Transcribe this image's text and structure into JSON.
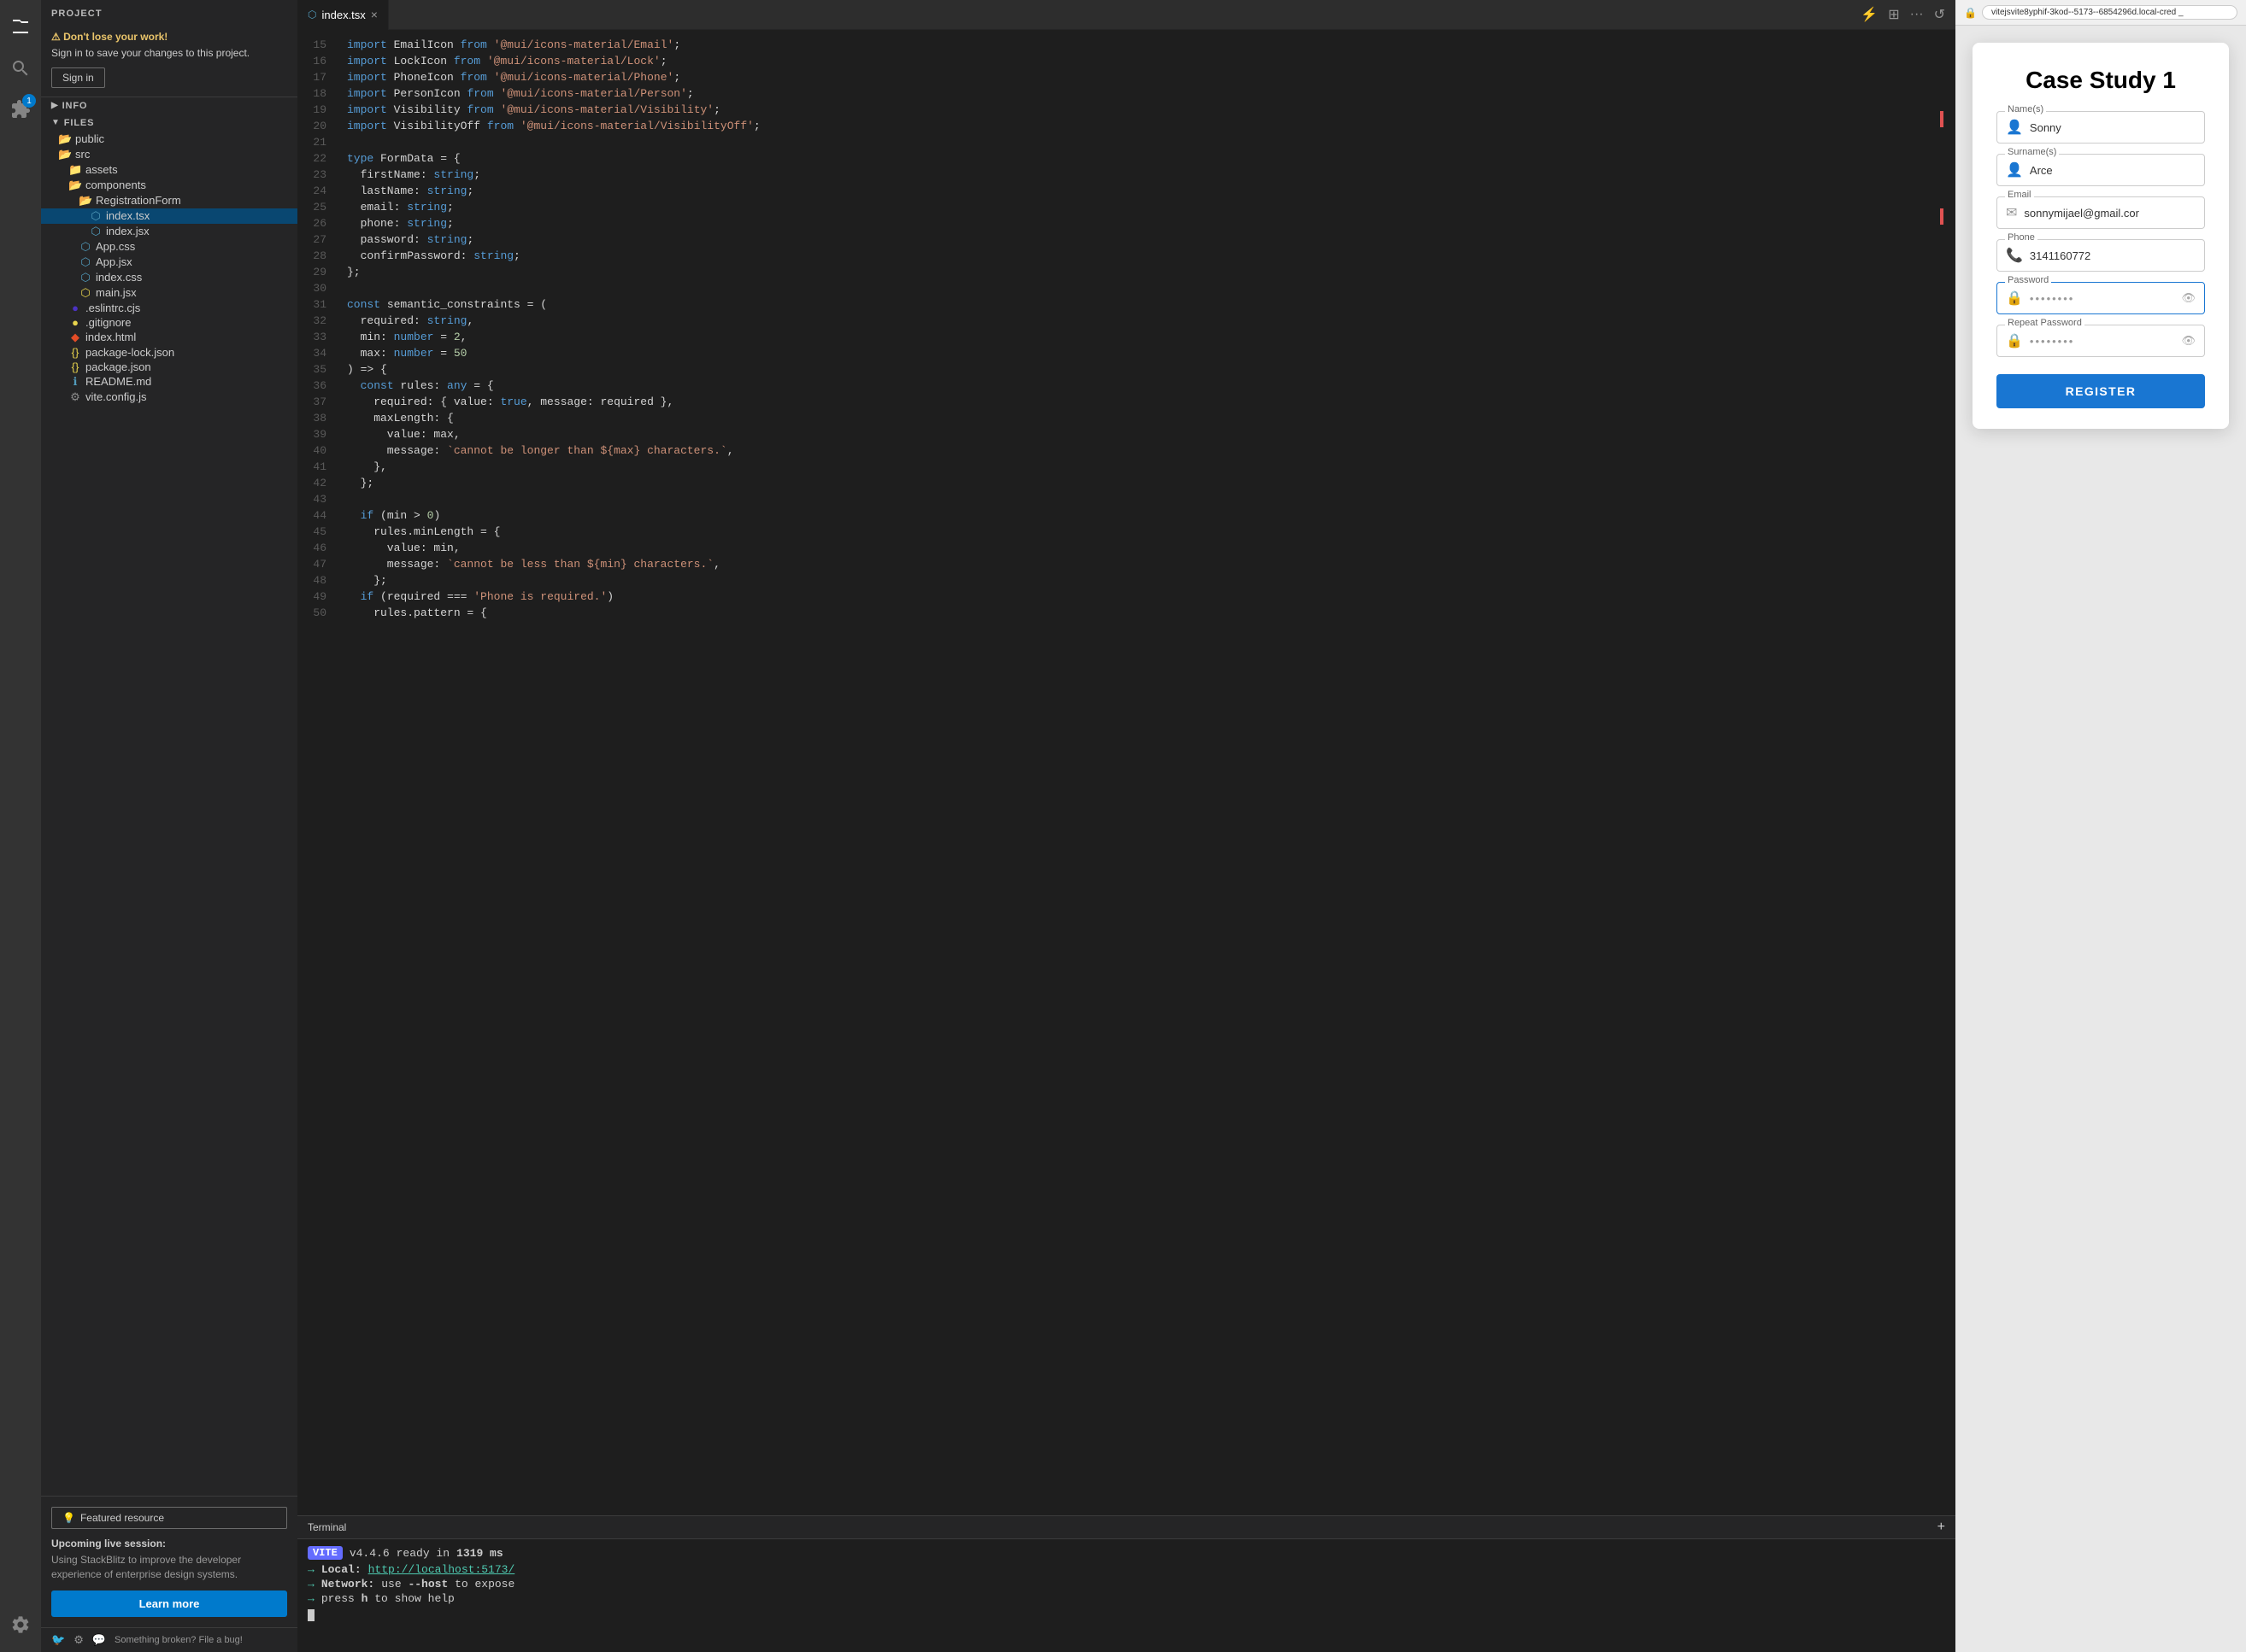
{
  "activityBar": {
    "icons": [
      "files",
      "search",
      "extensions",
      "settings"
    ]
  },
  "sidebar": {
    "projectLabel": "PROJECT",
    "warning": {
      "title": "⚠ Don't lose your work!",
      "text": "Sign in to save your changes to this project.",
      "signInLabel": "Sign in"
    },
    "infoSection": "INFO",
    "filesSection": "FILES",
    "fileTree": [
      {
        "name": "public",
        "type": "folder-open",
        "depth": 0
      },
      {
        "name": "src",
        "type": "folder-open",
        "depth": 0
      },
      {
        "name": "assets",
        "type": "folder",
        "depth": 1
      },
      {
        "name": "components",
        "type": "folder-open",
        "depth": 1
      },
      {
        "name": "RegistrationForm",
        "type": "folder-open",
        "depth": 2
      },
      {
        "name": "index.tsx",
        "type": "tsx",
        "depth": 3,
        "selected": true
      },
      {
        "name": "index.jsx",
        "type": "jsx",
        "depth": 3
      },
      {
        "name": "App.css",
        "type": "css",
        "depth": 2
      },
      {
        "name": "App.jsx",
        "type": "jsx",
        "depth": 2
      },
      {
        "name": "index.css",
        "type": "css",
        "depth": 2
      },
      {
        "name": "main.jsx",
        "type": "js",
        "depth": 2
      },
      {
        "name": ".eslintrc.cjs",
        "type": "eslint",
        "depth": 1
      },
      {
        "name": ".gitignore",
        "type": "git",
        "depth": 1
      },
      {
        "name": "index.html",
        "type": "html",
        "depth": 1
      },
      {
        "name": "package-lock.json",
        "type": "json",
        "depth": 1
      },
      {
        "name": "package.json",
        "type": "json",
        "depth": 1
      },
      {
        "name": "README.md",
        "type": "md",
        "depth": 1
      },
      {
        "name": "vite.config.js",
        "type": "config",
        "depth": 1
      }
    ],
    "featured": {
      "buttonLabel": "Featured resource",
      "upcomingTitle": "Upcoming live session:",
      "upcomingText": "Using StackBlitz to improve the developer experience of enterprise design systems.",
      "learnMoreLabel": "Learn more"
    },
    "footer": {
      "bugText": "Something broken? File a bug!"
    }
  },
  "editor": {
    "tab": {
      "filename": "index.tsx",
      "icon": "tsx"
    },
    "lines": [
      {
        "num": 15,
        "code": "import EmailIcon from '@mui/icons-material/Email';"
      },
      {
        "num": 16,
        "code": "import LockIcon from '@mui/icons-material/Lock';"
      },
      {
        "num": 17,
        "code": "import PhoneIcon from '@mui/icons-material/Phone';"
      },
      {
        "num": 18,
        "code": "import PersonIcon from '@mui/icons-material/Person';"
      },
      {
        "num": 19,
        "code": "import Visibility from '@mui/icons-material/Visibility';"
      },
      {
        "num": 20,
        "code": "import VisibilityOff from '@mui/icons-material/VisibilityOff';"
      },
      {
        "num": 21,
        "code": ""
      },
      {
        "num": 22,
        "code": "type FormData = {"
      },
      {
        "num": 23,
        "code": "  firstName: string;"
      },
      {
        "num": 24,
        "code": "  lastName: string;"
      },
      {
        "num": 25,
        "code": "  email: string;"
      },
      {
        "num": 26,
        "code": "  phone: string;"
      },
      {
        "num": 27,
        "code": "  password: string;"
      },
      {
        "num": 28,
        "code": "  confirmPassword: string;"
      },
      {
        "num": 29,
        "code": "};"
      },
      {
        "num": 30,
        "code": ""
      },
      {
        "num": 31,
        "code": "const semantic_constraints = ("
      },
      {
        "num": 32,
        "code": "  required: string,"
      },
      {
        "num": 33,
        "code": "  min: number = 2,"
      },
      {
        "num": 34,
        "code": "  max: number = 50"
      },
      {
        "num": 35,
        "code": ") => {"
      },
      {
        "num": 36,
        "code": "  const rules: any = {"
      },
      {
        "num": 37,
        "code": "    required: { value: true, message: required },"
      },
      {
        "num": 38,
        "code": "    maxLength: {"
      },
      {
        "num": 39,
        "code": "      value: max,"
      },
      {
        "num": 40,
        "code": "      message: `cannot be longer than ${max} characters.`,"
      },
      {
        "num": 41,
        "code": "    },"
      },
      {
        "num": 42,
        "code": "  };"
      },
      {
        "num": 43,
        "code": ""
      },
      {
        "num": 44,
        "code": "  if (min > 0)"
      },
      {
        "num": 45,
        "code": "    rules.minLength = {"
      },
      {
        "num": 46,
        "code": "      value: min,"
      },
      {
        "num": 47,
        "code": "      message: `cannot be less than ${min} characters.`,"
      },
      {
        "num": 48,
        "code": "    };"
      },
      {
        "num": 49,
        "code": "  if (required === 'Phone is required.')"
      },
      {
        "num": 50,
        "code": "    rules.pattern = {"
      }
    ]
  },
  "terminal": {
    "label": "Terminal",
    "viteVersion": "v4.4.6",
    "readyText": "ready in",
    "readyTime": "1319 ms",
    "localLabel": "Local:",
    "localUrl": "http://localhost:5173/",
    "networkLabel": "Network:",
    "networkText": "use",
    "networkFlag": "--host",
    "networkSuffix": "to expose",
    "pressText": "press",
    "pressKey": "h",
    "pressSuffix": "to show help"
  },
  "preview": {
    "urlBar": "vitejsvite8yphif-3kod--5173--6854296d.local-cred _",
    "card": {
      "title": "Case Study 1",
      "nameLabel": "Name(s)",
      "namePlaceholder": "Sonny",
      "surnameLabel": "Surname(s)",
      "surnamePlaceholder": "Arce",
      "emailLabel": "Email",
      "emailPlaceholder": "sonnymijael@gmail.cor",
      "phoneLabel": "Phone",
      "phonePlaceholder": "3141160772",
      "passwordLabel": "Password",
      "passwordPlaceholder": "••••••••",
      "repeatPasswordLabel": "Repeat Password",
      "repeatPasswordPlaceholder": "••••••••",
      "registerLabel": "REGISTER"
    }
  }
}
